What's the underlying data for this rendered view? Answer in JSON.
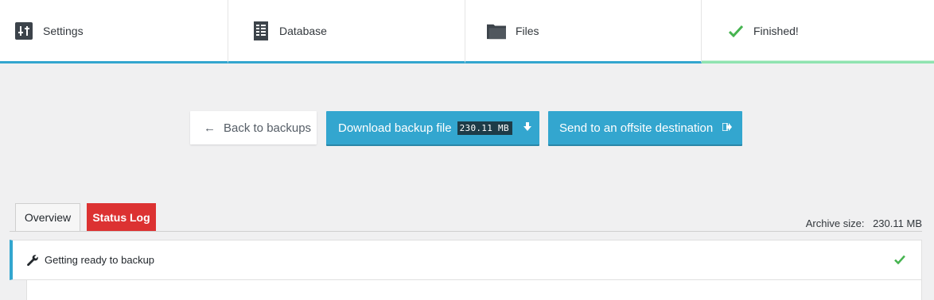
{
  "steps": [
    {
      "label": "Settings",
      "icon": "settings-icon"
    },
    {
      "label": "Database",
      "icon": "database-icon"
    },
    {
      "label": "Files",
      "icon": "folder-icon"
    },
    {
      "label": "Finished!",
      "icon": "check-icon"
    }
  ],
  "actions": {
    "back_label": "Back to backups",
    "download_label": "Download backup file",
    "download_size": "230.11 MB",
    "send_label": "Send to an offsite destination"
  },
  "tabs": {
    "overview": "Overview",
    "status_log": "Status Log"
  },
  "archive": {
    "label": "Archive size:",
    "value": "230.11 MB"
  },
  "log": {
    "items": [
      {
        "text": "Getting ready to backup",
        "status": "done"
      }
    ]
  },
  "colors": {
    "accent": "#33a6cf",
    "success": "#46b450",
    "danger": "#dc3232"
  }
}
